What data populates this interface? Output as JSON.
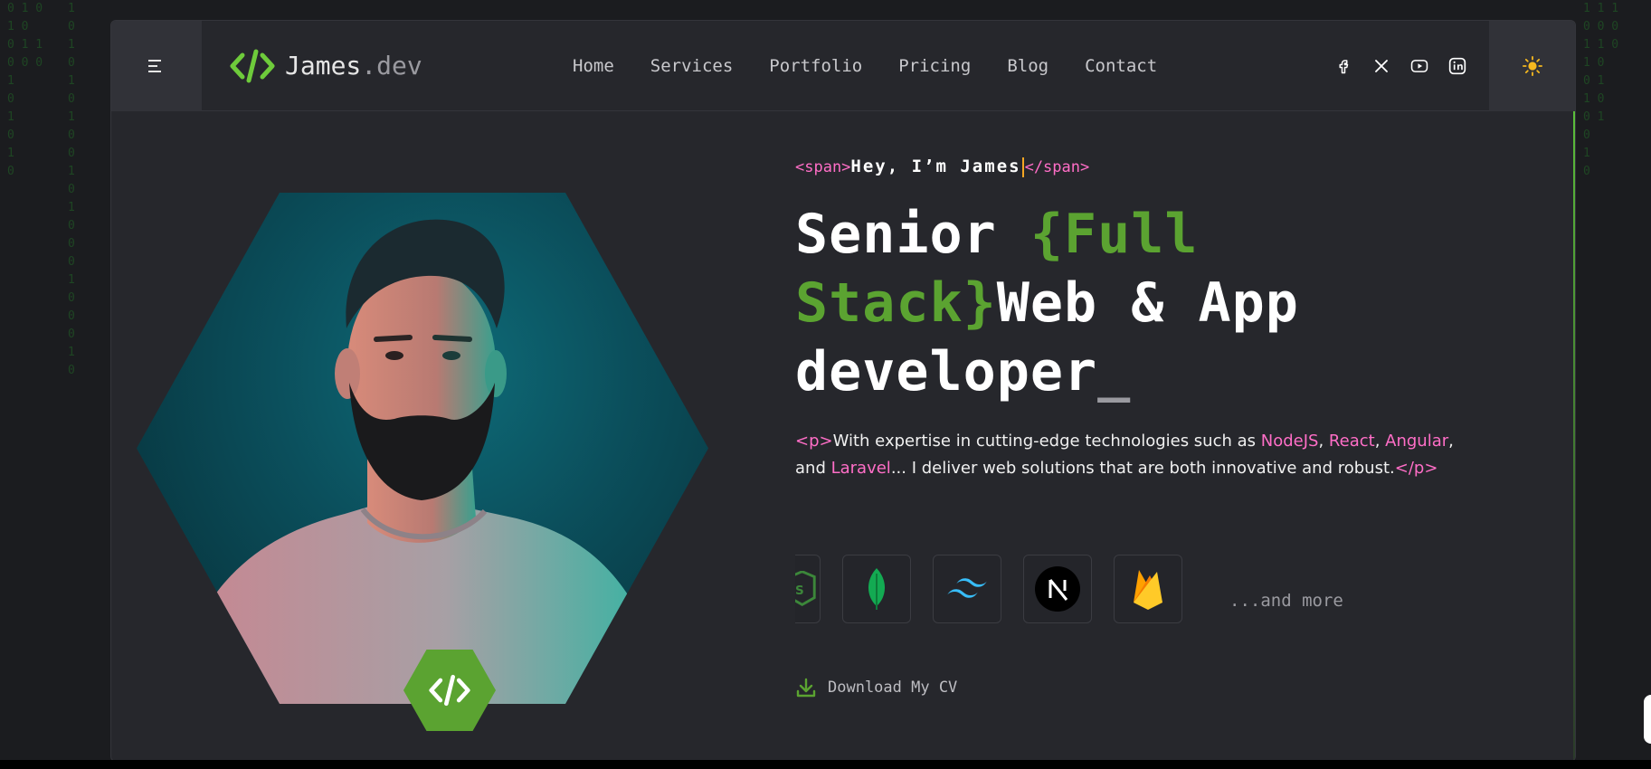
{
  "header": {
    "logo_main": "James",
    "logo_suffix": ".dev",
    "nav": [
      "Home",
      "Services",
      "Portfolio",
      "Pricing",
      "Blog",
      "Contact"
    ],
    "socials": [
      "facebook-icon",
      "x-twitter-icon",
      "youtube-icon",
      "linkedin-icon"
    ]
  },
  "hero": {
    "span_open": "<span>",
    "greeting": "Hey, I’m James",
    "span_close": "</span>",
    "title_part1": "Senior ",
    "title_green": "{Full Stack}",
    "title_part2": "Web & App developer",
    "title_cursor": "_",
    "p_open": "<p>",
    "desc_1": "With expertise in cutting-edge technologies such as ",
    "tech_node": "NodeJS",
    "sep1": ", ",
    "tech_react": "React",
    "sep2": ", ",
    "tech_angular": "Angular",
    "sep3": ", and ",
    "tech_laravel": "Laravel",
    "desc_2": "... I deliver web solutions that are both innovative and robust.",
    "p_close": "</p>",
    "tech_icons": [
      "nodejs-icon",
      "mongodb-icon",
      "tailwind-icon",
      "nextjs-icon",
      "firebase-icon"
    ],
    "more_label": "...and more",
    "cv_label": "Download My CV"
  },
  "colors": {
    "accent_green": "#5ba331",
    "tag_pink": "#ff6ec7",
    "background": "#26272c"
  }
}
